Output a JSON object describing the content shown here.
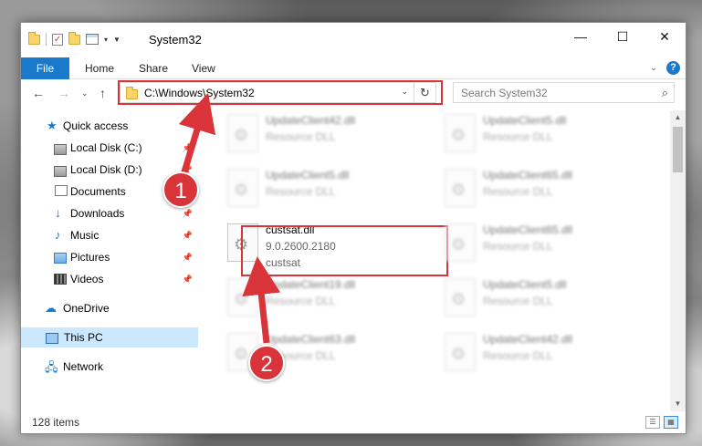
{
  "window": {
    "title": "System32",
    "caption": {
      "minimize": "—",
      "maximize": "☐",
      "close": "✕"
    }
  },
  "ribbon": {
    "tabs": [
      "File",
      "Home",
      "Share",
      "View"
    ],
    "expand": "⌄",
    "help": "?"
  },
  "address": {
    "path": "C:\\Windows\\System32",
    "refresh": "↻"
  },
  "search": {
    "placeholder": "Search System32"
  },
  "nav_pane": {
    "items": [
      {
        "label": "Quick access",
        "icon": "star-icon"
      },
      {
        "label": "Local Disk (C:)",
        "icon": "drive-icon",
        "pinned": true
      },
      {
        "label": "Local Disk (D:)",
        "icon": "drive-icon",
        "pinned": true
      },
      {
        "label": "Documents",
        "icon": "documents-icon",
        "pinned": true
      },
      {
        "label": "Downloads",
        "icon": "downloads-icon",
        "pinned": true
      },
      {
        "label": "Music",
        "icon": "music-icon",
        "pinned": true
      },
      {
        "label": "Pictures",
        "icon": "pictures-icon",
        "pinned": true
      },
      {
        "label": "Videos",
        "icon": "videos-icon",
        "pinned": true
      },
      {
        "label": "OneDrive",
        "icon": "cloud-icon"
      },
      {
        "label": "This PC",
        "icon": "pc-icon",
        "selected": true
      },
      {
        "label": "Network",
        "icon": "network-icon"
      }
    ]
  },
  "files": [
    {
      "name": "UpdateClient42.dll",
      "type": "Resource DLL",
      "blurred": true
    },
    {
      "name": "UpdateClient5.dll",
      "type": "Resource DLL",
      "blurred": true
    },
    {
      "name": "UpdateClient5.dll",
      "type": "Resource DLL",
      "blurred": true
    },
    {
      "name": "UpdateClient65.dll",
      "type": "Resource DLL",
      "blurred": true
    },
    {
      "name": "custsat.dll",
      "version": "9.0.2600.2180",
      "desc": "custsat",
      "blurred": false,
      "highlighted": true
    },
    {
      "name": "UpdateClient65.dll",
      "type": "Resource DLL",
      "blurred": true
    },
    {
      "name": "UpdateClient19.dll",
      "type": "Resource DLL",
      "blurred": true
    },
    {
      "name": "UpdateClient5.dll",
      "type": "Resource DLL",
      "blurred": true
    },
    {
      "name": "UpdateClient63.dll",
      "type": "Resource DLL",
      "blurred": true
    },
    {
      "name": "UpdateClient42.dll",
      "type": "Resource DLL",
      "blurred": true
    }
  ],
  "status": {
    "count": "128 items"
  },
  "annotations": {
    "step1": "1",
    "step2": "2",
    "color": "#d9343a"
  }
}
